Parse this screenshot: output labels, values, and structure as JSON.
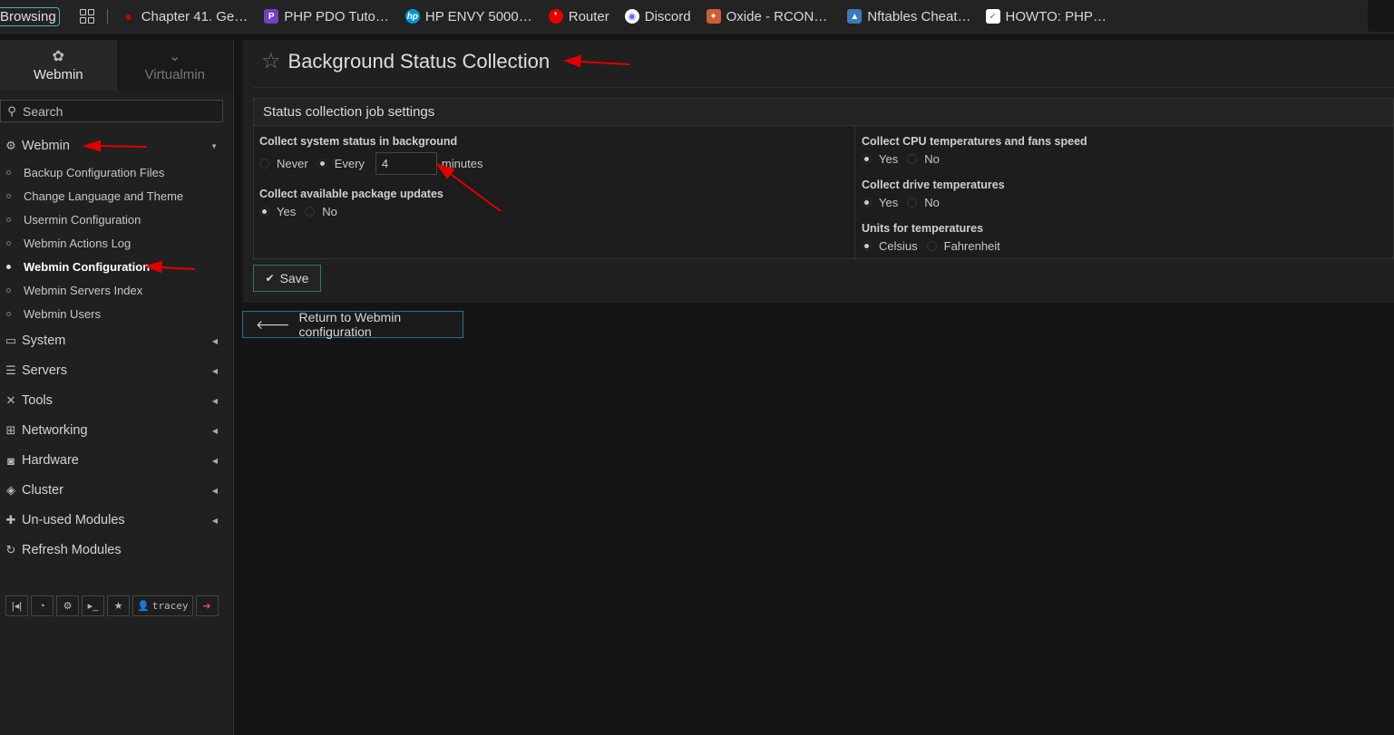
{
  "browser": {
    "browsing_label": "Browsing",
    "bookmarks": [
      {
        "label": "Chapter 41. Ge…",
        "icon": "redhat-icon",
        "color": "#cc0000"
      },
      {
        "label": "PHP PDO Tuto…",
        "icon": "php-icon",
        "color": "#6f42c1"
      },
      {
        "label": "HP ENVY 5000…",
        "icon": "hp-icon",
        "color": "#0096d6"
      },
      {
        "label": "Router",
        "icon": "vodafone-icon",
        "color": "#e60000"
      },
      {
        "label": "Discord",
        "icon": "discord-icon",
        "color": "#5865f2"
      },
      {
        "label": "Oxide - RCON…",
        "icon": "oxide-icon",
        "color": "#cd5d35"
      },
      {
        "label": "Nftables Cheat…",
        "icon": "linux-icon",
        "color": "#3a7ab8"
      },
      {
        "label": "HOWTO: PHP…",
        "icon": "check-icon",
        "color": "#2e8b57"
      }
    ]
  },
  "sidebar": {
    "tabs": [
      {
        "label": "Webmin",
        "icon": "webmin-icon"
      },
      {
        "label": "Virtualmin",
        "icon": "virtualmin-icon"
      }
    ],
    "search_label": "Search",
    "webmin_category": "Webmin",
    "webmin_items": [
      "Backup Configuration Files",
      "Change Language and Theme",
      "Usermin Configuration",
      "Webmin Actions Log",
      "Webmin Configuration",
      "Webmin Servers Index",
      "Webmin Users"
    ],
    "categories": [
      {
        "label": "System",
        "icon": "laptop-icon"
      },
      {
        "label": "Servers",
        "icon": "server-icon"
      },
      {
        "label": "Tools",
        "icon": "tools-icon"
      },
      {
        "label": "Networking",
        "icon": "network-icon"
      },
      {
        "label": "Hardware",
        "icon": "hardware-icon"
      },
      {
        "label": "Cluster",
        "icon": "layers-icon"
      },
      {
        "label": "Un-used Modules",
        "icon": "puzzle-icon"
      }
    ],
    "refresh_label": "Refresh Modules",
    "toolbar_user": "tracey"
  },
  "page": {
    "title": "Background Status Collection",
    "panel_title": "Status collection job settings",
    "collect_status": {
      "label": "Collect system status in background",
      "never": "Never",
      "every": "Every",
      "interval": "4",
      "unit": "minutes",
      "selected": "every"
    },
    "collect_updates": {
      "label": "Collect available package updates",
      "yes": "Yes",
      "no": "No",
      "selected": "yes"
    },
    "cpu_temps": {
      "label": "Collect CPU temperatures and fans speed",
      "yes": "Yes",
      "no": "No",
      "selected": "yes"
    },
    "drive_temps": {
      "label": "Collect drive temperatures",
      "yes": "Yes",
      "no": "No",
      "selected": "yes"
    },
    "temp_units": {
      "label": "Units for temperatures",
      "celsius": "Celsius",
      "fahrenheit": "Fahrenheit",
      "selected": "celsius"
    },
    "save_label": "Save",
    "return_label": "Return to Webmin configuration"
  },
  "annotation_color": "#e00000"
}
